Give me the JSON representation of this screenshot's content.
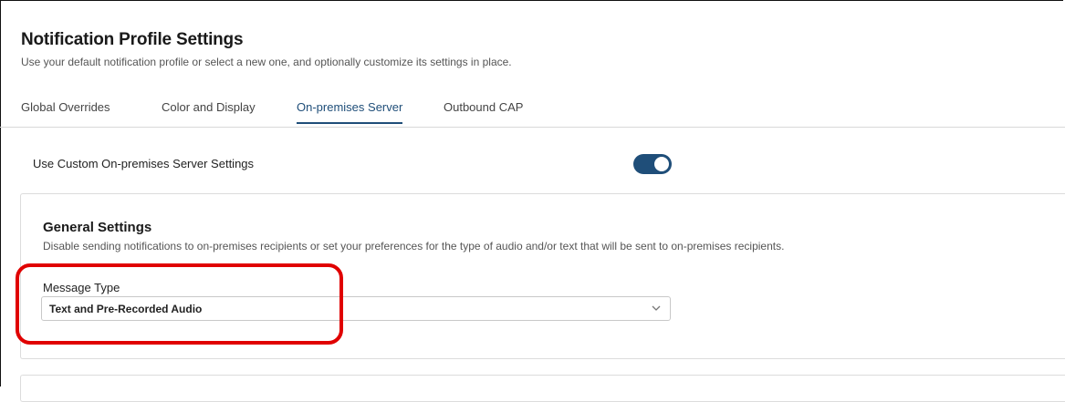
{
  "header": {
    "title": "Notification Profile Settings",
    "subtitle": "Use your default notification profile or select a new one, and optionally customize its settings in place."
  },
  "tabs": [
    {
      "label": "Global Overrides",
      "active": false
    },
    {
      "label": "Color and Display",
      "active": false
    },
    {
      "label": "On-premises Server",
      "active": true
    },
    {
      "label": "Outbound CAP",
      "active": false
    }
  ],
  "custom_settings": {
    "label": "Use Custom On-premises Server Settings",
    "toggle_on": true
  },
  "general_settings": {
    "title": "General Settings",
    "description": "Disable sending notifications to on-premises recipients or set your preferences for the type of audio and/or text that will be sent to on-premises recipients.",
    "message_type": {
      "label": "Message Type",
      "value": "Text and Pre-Recorded Audio"
    }
  },
  "colors": {
    "accent": "#1f4e79",
    "highlight": "#e00000"
  },
  "icons": {
    "select_chevron": "chevron-down-icon"
  }
}
